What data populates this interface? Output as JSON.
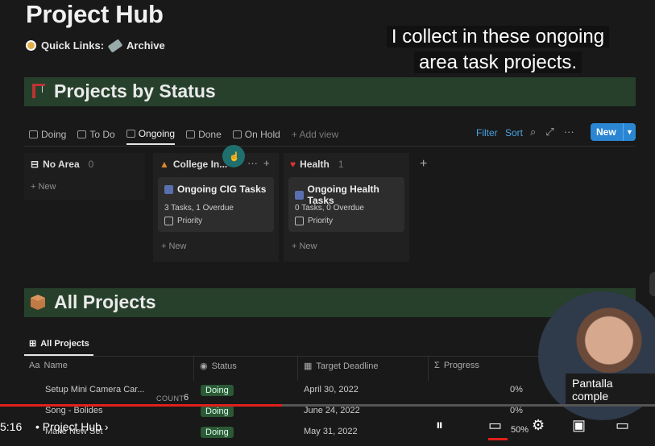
{
  "page": {
    "title": "Project Hub",
    "quick_links_label": "Quick Links:",
    "archive_label": "Archive"
  },
  "overlay_caption": {
    "line1": "I collect in these ongoing",
    "line2": "area task projects."
  },
  "section_status": {
    "title": "Projects by Status",
    "tabs": [
      "Doing",
      "To Do",
      "Ongoing",
      "Done",
      "On Hold",
      "+ Add view"
    ],
    "active_tab": "Ongoing",
    "toolbar": {
      "filter": "Filter",
      "sort": "Sort",
      "new": "New",
      "search_icon": "search-icon",
      "expand_icon": "expand-icon",
      "more_icon": "more-icon"
    },
    "columns": [
      {
        "name": "No Area",
        "count": "0",
        "new_label": "+ New"
      },
      {
        "name": "College In...",
        "count": "",
        "card": {
          "title": "Ongoing CIG Tasks",
          "summary": "3 Tasks, 1 Overdue",
          "priority": "Priority"
        },
        "new_label": "+ New"
      },
      {
        "name": "Health",
        "count": "1",
        "card": {
          "title": "Ongoing Health Tasks",
          "summary": "0 Tasks, 0 Overdue",
          "priority": "Priority"
        },
        "new_label": "+ New"
      }
    ],
    "add_column": "+"
  },
  "section_all": {
    "title": "All Projects",
    "view_tab": "All Projects",
    "columns": [
      "Name",
      "Status",
      "Target Deadline",
      "Progress"
    ],
    "rows": [
      {
        "name": "Setup Mini Camera Car...",
        "status": "Doing",
        "deadline": "April 30, 2022",
        "progress": "0%"
      },
      {
        "name": "Song - Bolides",
        "status": "Doing",
        "deadline": "June 24, 2022",
        "progress": "0%"
      },
      {
        "name": "Make New Set",
        "status": "Doing",
        "deadline": "May 31, 2022",
        "progress": "50%"
      }
    ],
    "count_label": "COUNT",
    "count_value": "6"
  },
  "player": {
    "time": "5:16",
    "chapter": "Project Hub",
    "tooltip": "Pantalla comple",
    "progress_fraction": 0.43,
    "icons": [
      "pause-icon",
      "subtitles-icon",
      "settings-icon",
      "miniplayer-icon",
      "theater-icon"
    ]
  }
}
